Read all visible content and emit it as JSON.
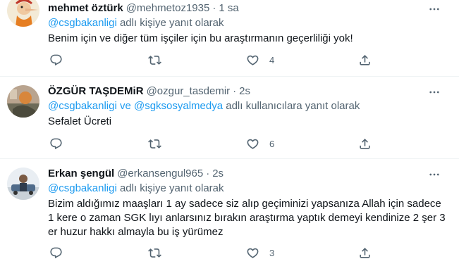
{
  "tweets": [
    {
      "name": "mehmet öztürk",
      "handle": "@mehmetoz1935",
      "dot": "·",
      "time": "1 sa",
      "reply_mentions": [
        "@csgbakanligi"
      ],
      "reply_joiner": "",
      "reply_suffix": " adlı kişiye yanıt olarak",
      "body": "Benim için ve diğer tüm işçiler için bu araştırmanın geçerliliği yok!",
      "likes": "4"
    },
    {
      "name": "ÖZGÜR TAŞDEMiR",
      "handle": "@ozgur_tasdemir",
      "dot": "·",
      "time": "2s",
      "reply_mentions": [
        "@csgbakanligi",
        "@sgksosyalmedya"
      ],
      "reply_joiner": " ve ",
      "reply_suffix": " adlı kullanıcılara yanıt olarak",
      "body": "Sefalet Ücreti",
      "likes": "6"
    },
    {
      "name": "Erkan şengül",
      "handle": "@erkansengul965",
      "dot": "·",
      "time": "2s",
      "reply_mentions": [
        "@csgbakanligi"
      ],
      "reply_joiner": "",
      "reply_suffix": " adlı kişiye yanıt olarak",
      "body": "Bizim aldığımız maaşları 1 ay sadece siz alıp geçiminizi yapsanıza Allah için sadece 1 kere o zaman SGK lıyı anlarsınız bırakın araştırma yaptık demeyi kendinize 2 şer 3 er huzur hakkı almayla bu iş yürümez",
      "likes": "3"
    }
  ],
  "icons": {
    "more": "more-icon",
    "reply": "reply-icon",
    "retweet": "retweet-icon",
    "like": "like-icon",
    "share": "share-icon"
  },
  "colors": {
    "link": "#1d9bf0",
    "secondary_text": "#536471",
    "primary_text": "#0f1419",
    "divider": "#eff3f4"
  }
}
